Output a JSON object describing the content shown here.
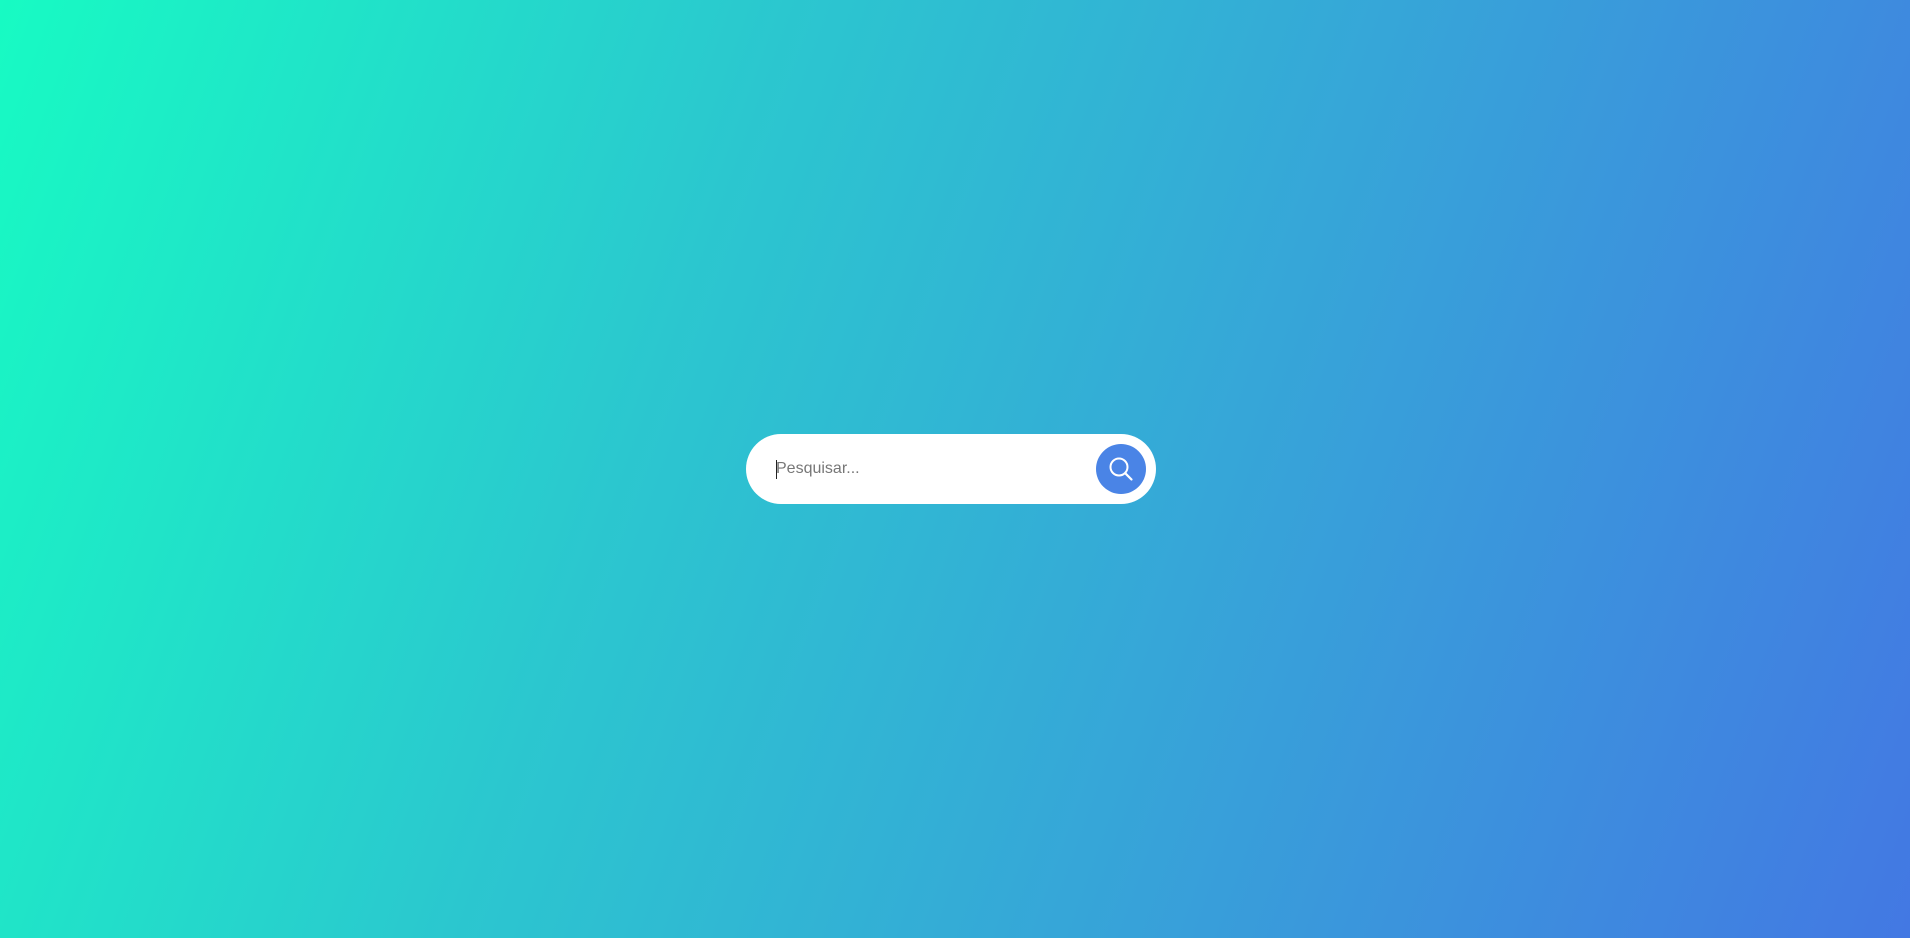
{
  "search": {
    "placeholder": "Pesquisar...",
    "value": "",
    "button_icon": "search-icon"
  },
  "colors": {
    "gradient_start": "#17fbc3",
    "gradient_end": "#4378e3",
    "button": "#4a84e6",
    "bar": "#ffffff"
  }
}
